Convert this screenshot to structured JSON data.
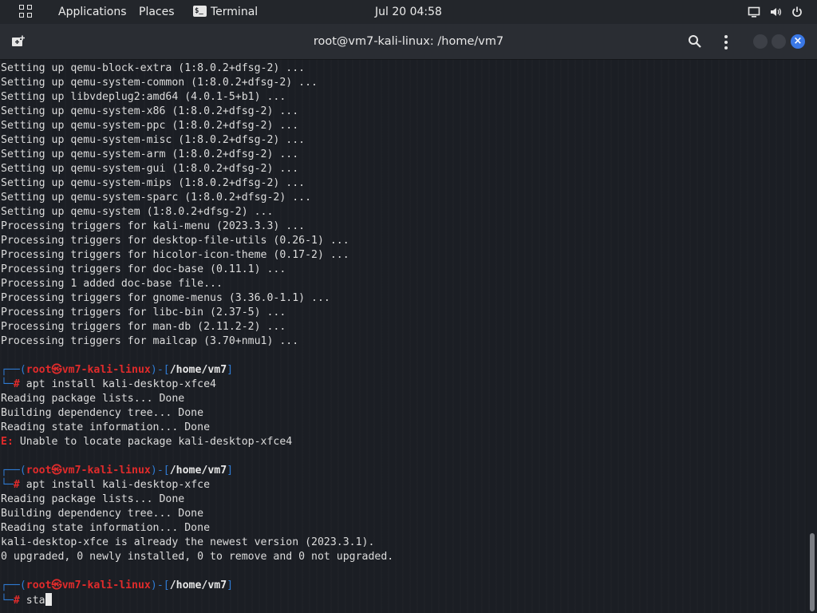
{
  "topbar": {
    "applications": "Applications",
    "places": "Places",
    "terminal_app": "Terminal",
    "terminal_glyph": "$_",
    "clock": "Jul 20  04:58"
  },
  "window": {
    "title": "root@vm7-kali-linux: /home/vm7"
  },
  "terminal": {
    "output1": [
      "Setting up qemu-block-extra (1:8.0.2+dfsg-2) ...",
      "Setting up qemu-system-common (1:8.0.2+dfsg-2) ...",
      "Setting up libvdeplug2:amd64 (4.0.1-5+b1) ...",
      "Setting up qemu-system-x86 (1:8.0.2+dfsg-2) ...",
      "Setting up qemu-system-ppc (1:8.0.2+dfsg-2) ...",
      "Setting up qemu-system-misc (1:8.0.2+dfsg-2) ...",
      "Setting up qemu-system-arm (1:8.0.2+dfsg-2) ...",
      "Setting up qemu-system-gui (1:8.0.2+dfsg-2) ...",
      "Setting up qemu-system-mips (1:8.0.2+dfsg-2) ...",
      "Setting up qemu-system-sparc (1:8.0.2+dfsg-2) ...",
      "Setting up qemu-system (1:8.0.2+dfsg-2) ...",
      "Processing triggers for kali-menu (2023.3.3) ...",
      "Processing triggers for desktop-file-utils (0.26-1) ...",
      "Processing triggers for hicolor-icon-theme (0.17-2) ...",
      "Processing triggers for doc-base (0.11.1) ...",
      "Processing 1 added doc-base file...",
      "Processing triggers for gnome-menus (3.36.0-1.1) ...",
      "Processing triggers for libc-bin (2.37-5) ...",
      "Processing triggers for man-db (2.11.2-2) ...",
      "Processing triggers for mailcap (3.70+nmu1) ..."
    ],
    "prompt": {
      "user": "root",
      "at": "㉿",
      "host": "vm7-kali-linux",
      "dir": "/home/vm7",
      "symbol": "#"
    },
    "cmd1": "apt install kali-desktop-xfce4",
    "output2": [
      "Reading package lists... Done",
      "Building dependency tree... Done",
      "Reading state information... Done"
    ],
    "error_prefix": "E:",
    "error_msg": "Unable to locate package kali-desktop-xfce4",
    "cmd2": "apt install kali-desktop-xfce",
    "output3": [
      "Reading package lists... Done",
      "Building dependency tree... Done",
      "Reading state information... Done",
      "kali-desktop-xfce is already the newest version (2023.3.1).",
      "0 upgraded, 0 newly installed, 0 to remove and 0 not upgraded."
    ],
    "current_input": "sta"
  }
}
